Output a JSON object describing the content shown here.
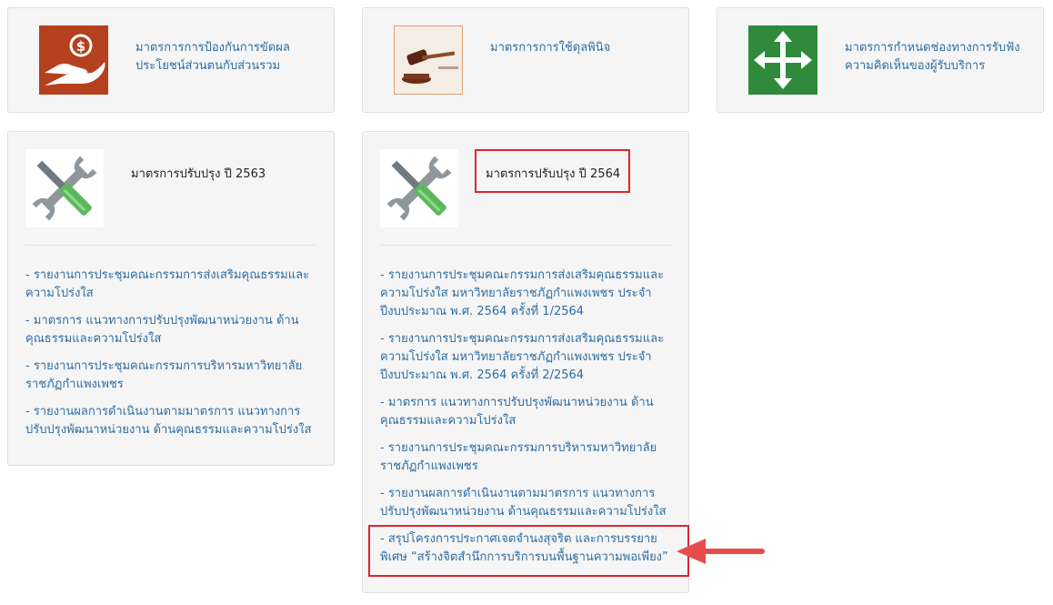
{
  "top_cards": [
    {
      "name": "conflict-of-interest",
      "icon": "hand-money-icon",
      "label": "มาตรการการป้องกันการขัดผลประโยชน์ส่วนตนกับส่วนรวม",
      "color": "#b5401d"
    },
    {
      "name": "discretion",
      "icon": "gavel-icon",
      "label": "มาตรการการใช้ดุลพินิจ"
    },
    {
      "name": "feedback-channel",
      "icon": "move-arrows-icon",
      "label": "มาตรการกำหนดช่องทางการรับฟังความคิดเห็นของผู้รับบริการ",
      "color": "#2f8a3c"
    }
  ],
  "section_2563": {
    "icon": "wrench-screwdriver-icon",
    "title": "มาตรการปรับปรุง ปี 2563",
    "links": [
      "- รายงานการประชุมคณะกรรมการส่งเสริมคุณธรรมและความโปร่งใส",
      "- มาตรการ แนวทางการปรับปรุงพัฒนาหน่วยงาน ด้านคุณธรรมและความโปร่งใส",
      "- รายงานการประชุมคณะกรรมการบริหารมหาวิทยาลัยราชภัฏกำแพงเพชร",
      "- รายงานผลการดำเนินงานตามมาตรการ แนวทางการปรับปรุงพัฒนาหน่วยงาน ด้านคุณธรรมและความโปร่งใส"
    ]
  },
  "section_2564": {
    "icon": "wrench-screwdriver-icon",
    "title": "มาตรการปรับปรุง ปี 2564",
    "links": [
      "- รายงานการประชุมคณะกรรมการส่งเสริมคุณธรรมและความโปร่งใส มหาวิทยาลัยราชภัฏกำแพงเพชร ประจำปีงบประมาณ พ.ศ. 2564 ครั้งที่ 1/2564",
      "- รายงานการประชุมคณะกรรมการส่งเสริมคุณธรรมและความโปร่งใส มหาวิทยาลัยราชภัฏกำแพงเพชร ประจำปีงบประมาณ พ.ศ. 2564 ครั้งที่ 2/2564",
      "- มาตรการ แนวทางการปรับปรุงพัฒนาหน่วยงาน ด้านคุณธรรมและความโปร่งใส",
      "- รายงานการประชุมคณะกรรมการบริหารมหาวิทยาลัยราชภัฏกำแพงเพชร",
      "- รายงานผลการดำเนินงานตามมาตรการ แนวทางการปรับปรุงพัฒนาหน่วยงาน ด้านคุณธรรมและความโปร่งใส",
      "- สรุปโครงการประกาศเจตจำนงสุจริต และการบรรยายพิเศษ “สร้างจิตสำนึกการบริการบนพื้นฐานความพอเพียง”"
    ]
  },
  "annotations": {
    "highlight_color": "#e0242e",
    "arrow": "red-arrow-icon"
  }
}
